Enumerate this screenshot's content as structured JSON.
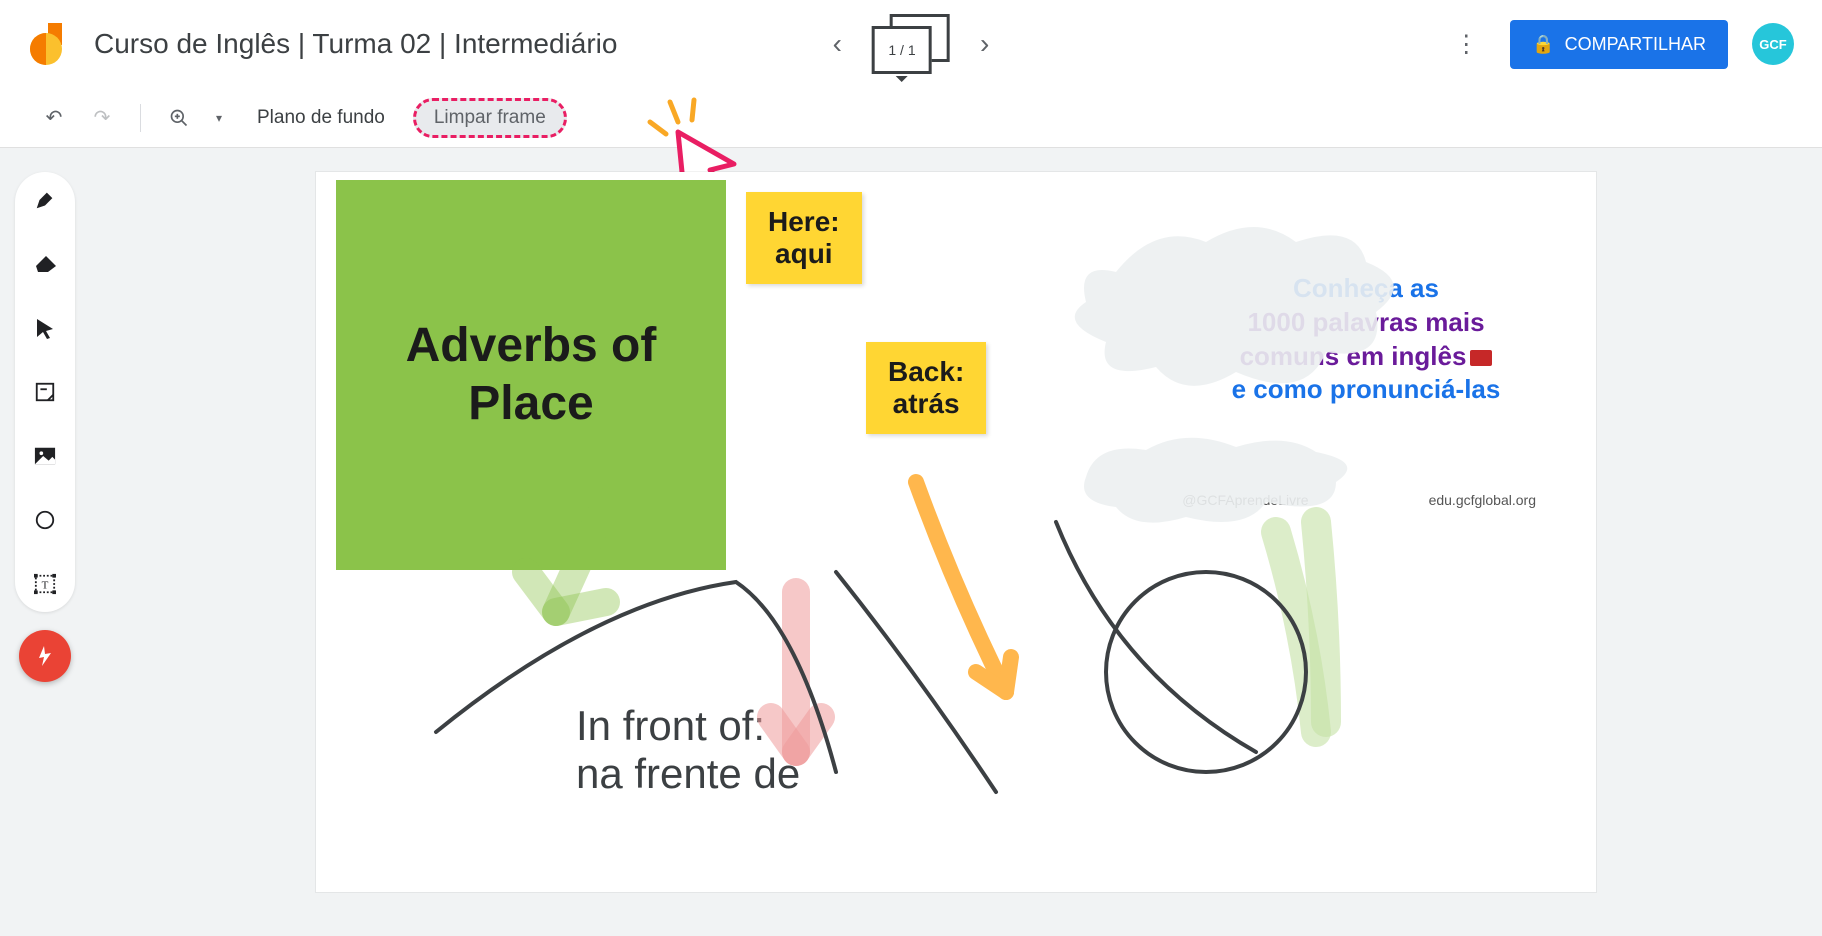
{
  "header": {
    "title": "Curso de Inglês | Turma 02 | Intermediário",
    "frame_counter": "1 / 1",
    "share_label": "COMPARTILHAR",
    "avatar_text": "GCF"
  },
  "toolbar": {
    "background_label": "Plano de fundo",
    "clear_frame_label": "Limpar frame"
  },
  "canvas": {
    "green_card": "Adverbs of Place",
    "note_here_l1": "Here:",
    "note_here_l2": "aqui",
    "note_back_l1": "Back:",
    "note_back_l2": "atrás",
    "infront_l1": "In front of:",
    "infront_l2": "na frente de",
    "promo_l1": "Conheça as",
    "promo_l2": "1000 palavras mais",
    "promo_l3": "comuns em inglês",
    "promo_l4": "e como pronunciá-las",
    "promo_handle": "@GCFAprendeLivre",
    "promo_url": "edu.gcfglobal.org"
  },
  "icons": {
    "undo": "↶",
    "redo": "↷",
    "zoom": "⊕",
    "dropdown": "▾",
    "prev": "‹",
    "next": "›",
    "more": "⋮",
    "lock": "🔒",
    "fab": "ϟ"
  }
}
